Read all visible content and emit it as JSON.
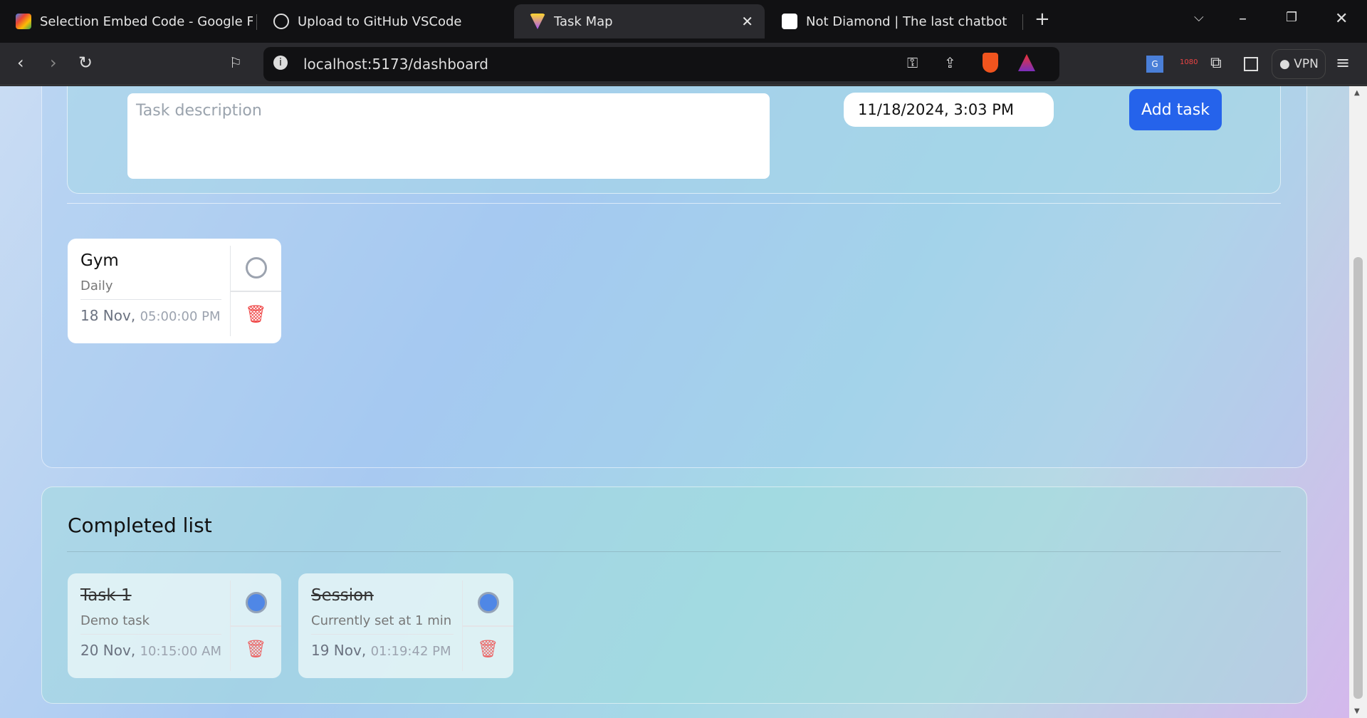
{
  "browser": {
    "tabs": [
      {
        "title": "Selection Embed Code - Google For",
        "icon": "google-forms-icon"
      },
      {
        "title": "Upload to GitHub VSCode",
        "icon": "chatgpt-icon"
      },
      {
        "title": "Task Map",
        "icon": "vite-icon",
        "active": true
      },
      {
        "title": "Not Diamond | The last chatbot you",
        "icon": "notdiamond-icon"
      }
    ],
    "url": "localhost:5173/dashboard",
    "vpn_label": "VPN",
    "ext_badge": "1080"
  },
  "form": {
    "description_placeholder": "Task description",
    "description_value": "",
    "datetime_value": "11/18/2024, 3:03 PM",
    "add_label": "Add task"
  },
  "tasks": [
    {
      "title": "Gym",
      "description": "Daily",
      "date": "18 Nov,",
      "time": "05:00:00 PM",
      "completed": false
    }
  ],
  "completed": {
    "heading": "Completed list",
    "tasks": [
      {
        "title": "Task 1",
        "description": "Demo task",
        "date": "20 Nov,",
        "time": "10:15:00 AM",
        "completed": true
      },
      {
        "title": "Session",
        "description": "Currently set at 1 min",
        "date": "19 Nov,",
        "time": "01:19:42 PM",
        "completed": true
      }
    ]
  },
  "colors": {
    "accent": "#2563eb",
    "delete": "#ef4444",
    "check": "#4f87e6"
  }
}
